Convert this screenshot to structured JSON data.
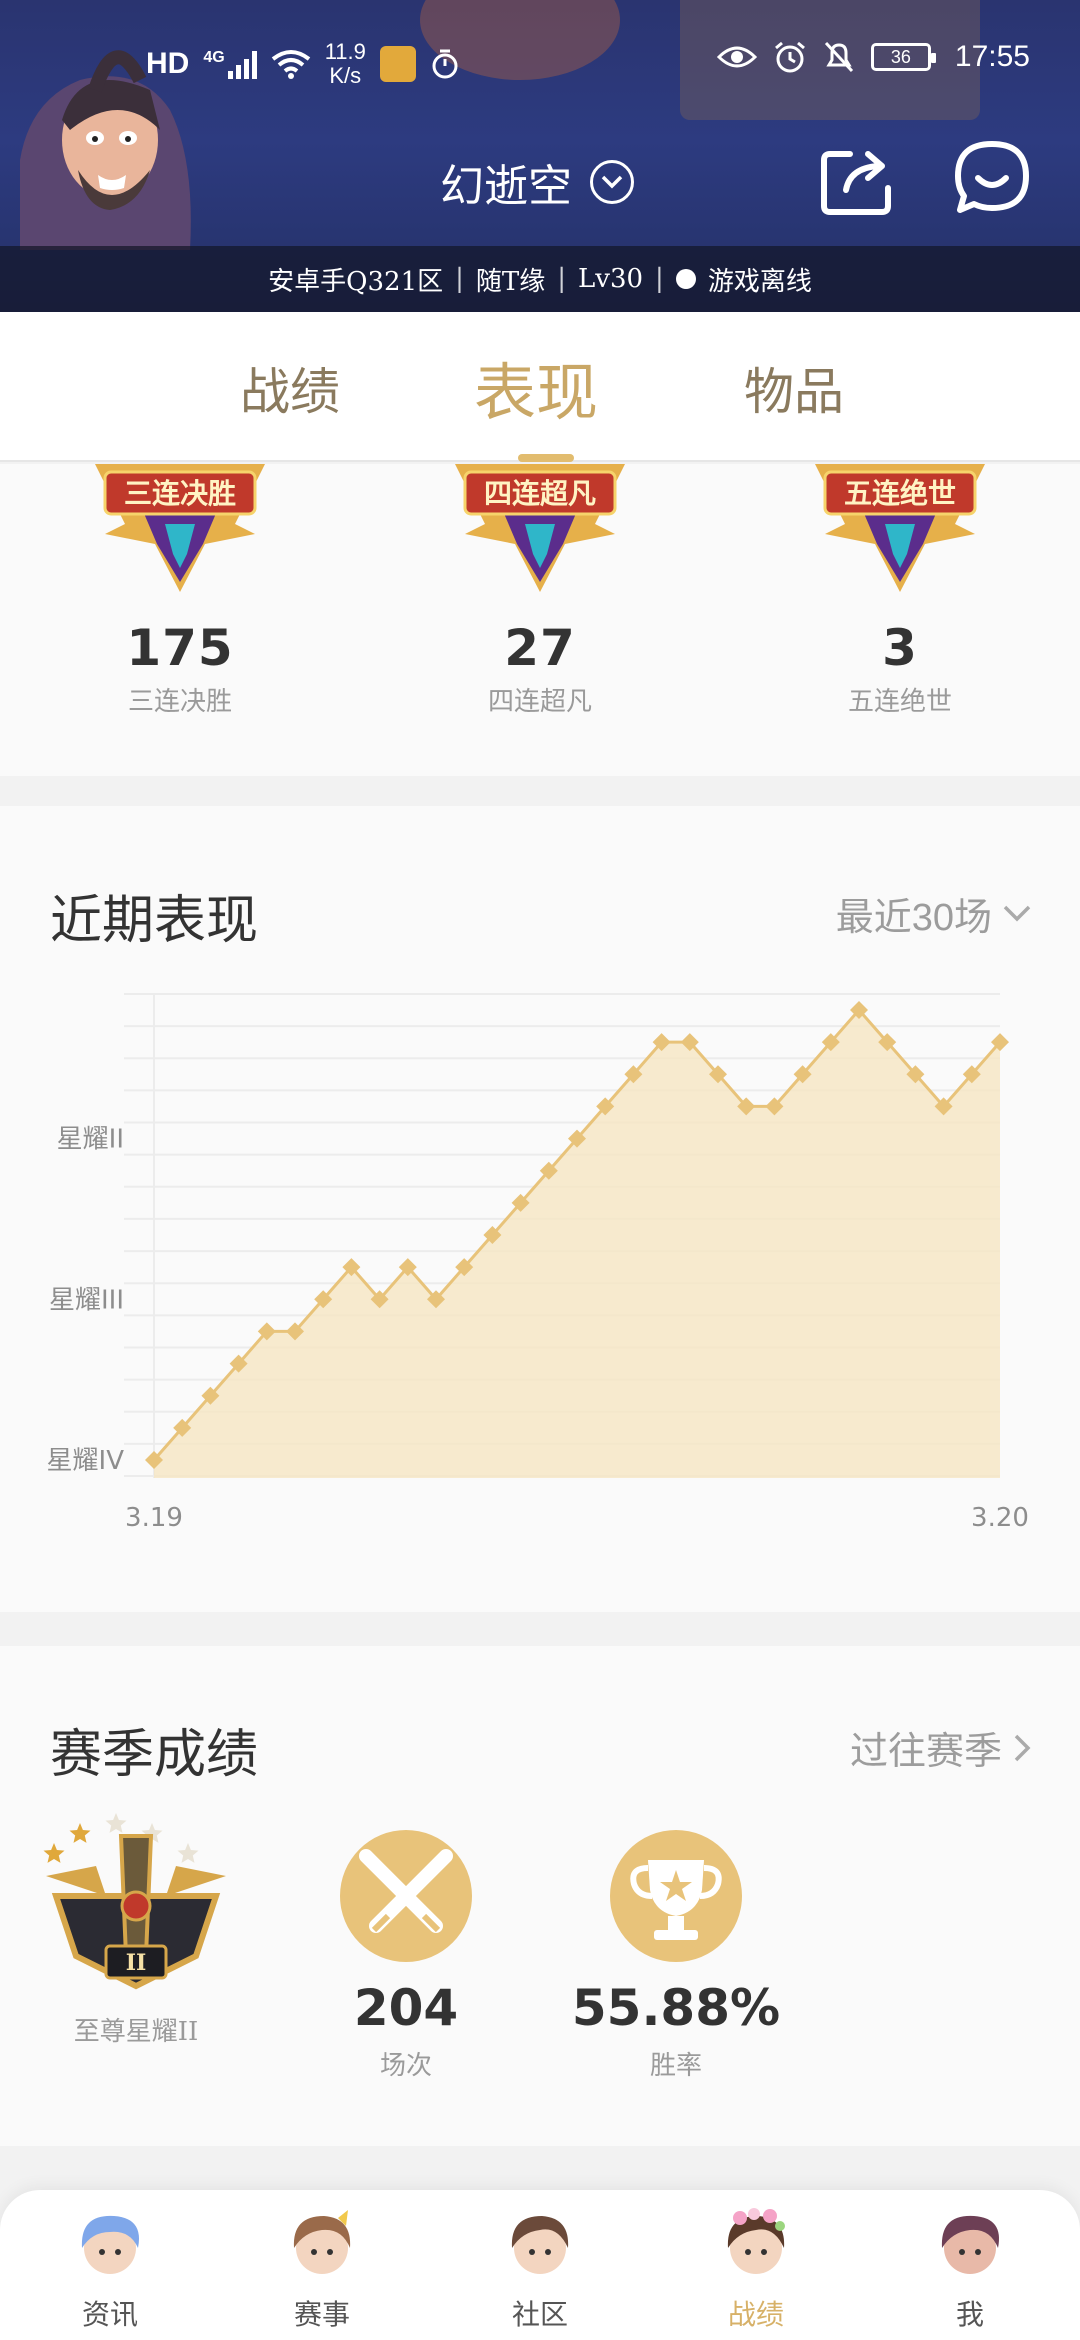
{
  "status_bar": {
    "network": "HD",
    "signal": "4G",
    "speed_value": "11.9",
    "speed_unit": "K/s",
    "battery": "36",
    "time": "17:55"
  },
  "header": {
    "player_name": "幻逝空",
    "info": {
      "server": "安卓手Q321区",
      "nickname": "随T缘",
      "level": "Lv30",
      "status": "游戏离线"
    }
  },
  "tabs": [
    {
      "label": "战绩",
      "active": false
    },
    {
      "label": "表现",
      "active": true
    },
    {
      "label": "物品",
      "active": false
    }
  ],
  "achievements": [
    {
      "badge_text": "三连决胜",
      "count": "175",
      "label": "三连决胜"
    },
    {
      "badge_text": "四连超凡",
      "count": "27",
      "label": "四连超凡"
    },
    {
      "badge_text": "五连绝世",
      "count": "3",
      "label": "五连绝世"
    }
  ],
  "recent": {
    "title": "近期表现",
    "filter": "最近30场"
  },
  "chart_data": {
    "type": "area",
    "y_tick_labels": [
      "星耀IV",
      "星耀III",
      "星耀II"
    ],
    "x_tick_labels": [
      "3.19",
      "3.20"
    ],
    "values": [
      0,
      1,
      2,
      3,
      4,
      4,
      5,
      6,
      5,
      6,
      5,
      6,
      7,
      8,
      9,
      10,
      11,
      12,
      13,
      13,
      12,
      11,
      11,
      12,
      13,
      14,
      13,
      12,
      11,
      12,
      13
    ],
    "ylim": [
      0,
      14
    ],
    "grid": true,
    "color": "#e8c37a",
    "fill": "#f6e6c6"
  },
  "season": {
    "title": "赛季成绩",
    "past_link": "过往赛季",
    "rank_label": "至尊星耀II",
    "rank_roman": "II",
    "rank_stars_lit": 2,
    "rank_stars_total": 5,
    "games_value": "204",
    "games_label": "场次",
    "winrate_value": "55.88%",
    "winrate_label": "胜率"
  },
  "nav": [
    {
      "label": "资讯",
      "active": false
    },
    {
      "label": "赛事",
      "active": false
    },
    {
      "label": "社区",
      "active": false
    },
    {
      "label": "战绩",
      "active": true
    },
    {
      "label": "我",
      "active": false
    }
  ],
  "colors": {
    "accent": "#d9b56a",
    "header_bg": "#2d3b80",
    "badge_red": "#c0392b"
  }
}
